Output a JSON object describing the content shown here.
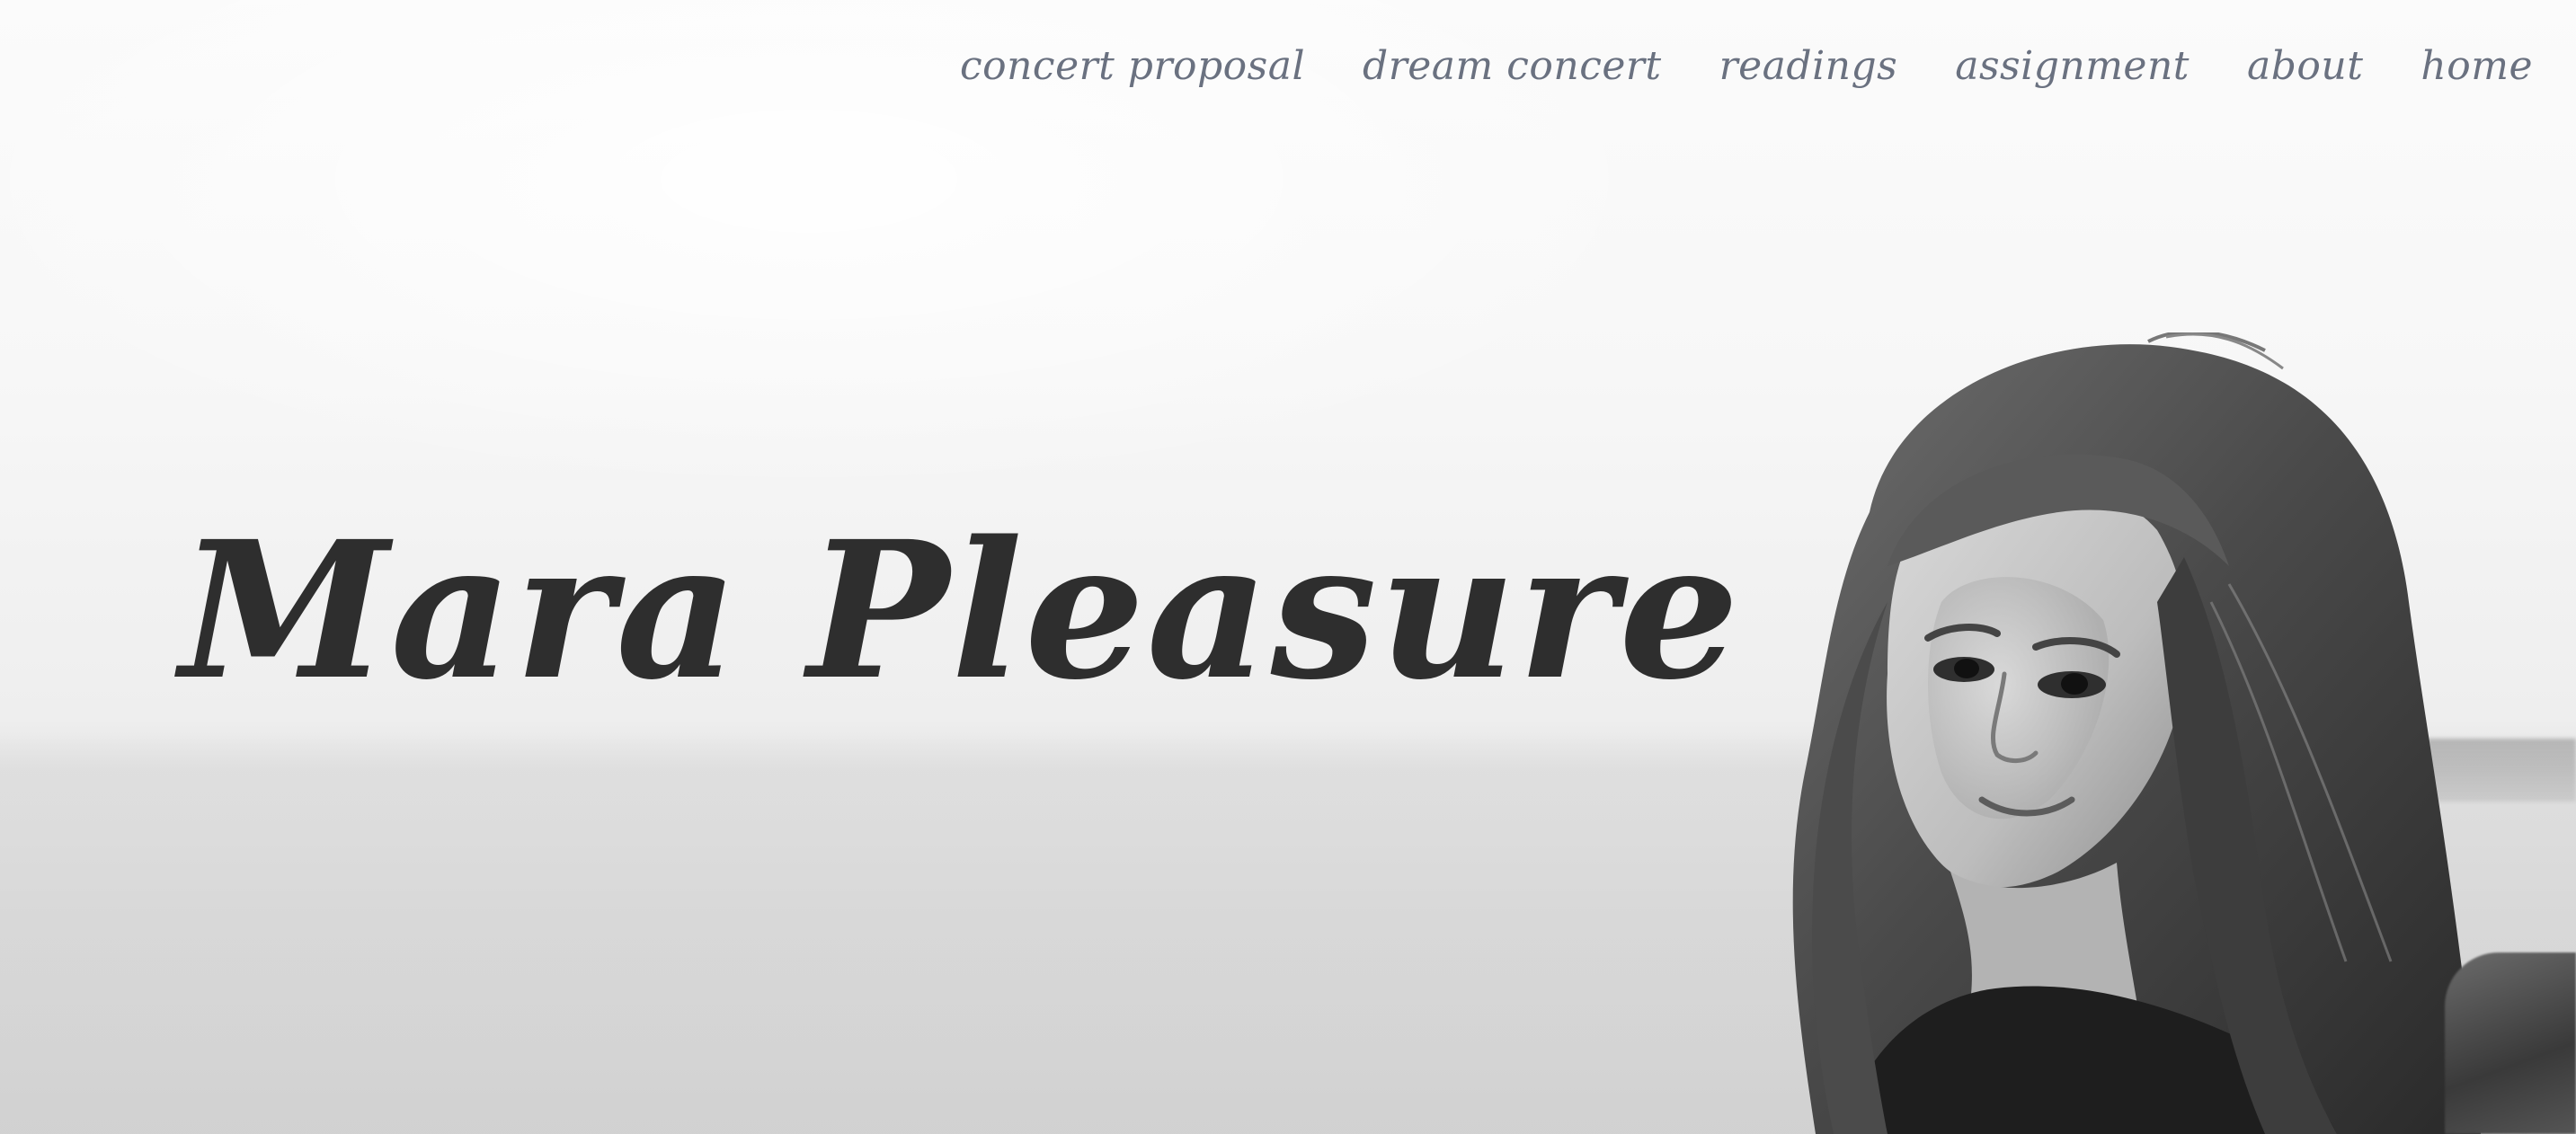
{
  "nav": {
    "items": [
      {
        "label": "concert proposal"
      },
      {
        "label": "dream concert"
      },
      {
        "label": "readings"
      },
      {
        "label": "assignment"
      },
      {
        "label": "about"
      },
      {
        "label": "home"
      }
    ],
    "color": "#6a7180"
  },
  "hero": {
    "title": "Mara Pleasure",
    "title_color": "#2e2e2e",
    "style": "grayscale"
  }
}
